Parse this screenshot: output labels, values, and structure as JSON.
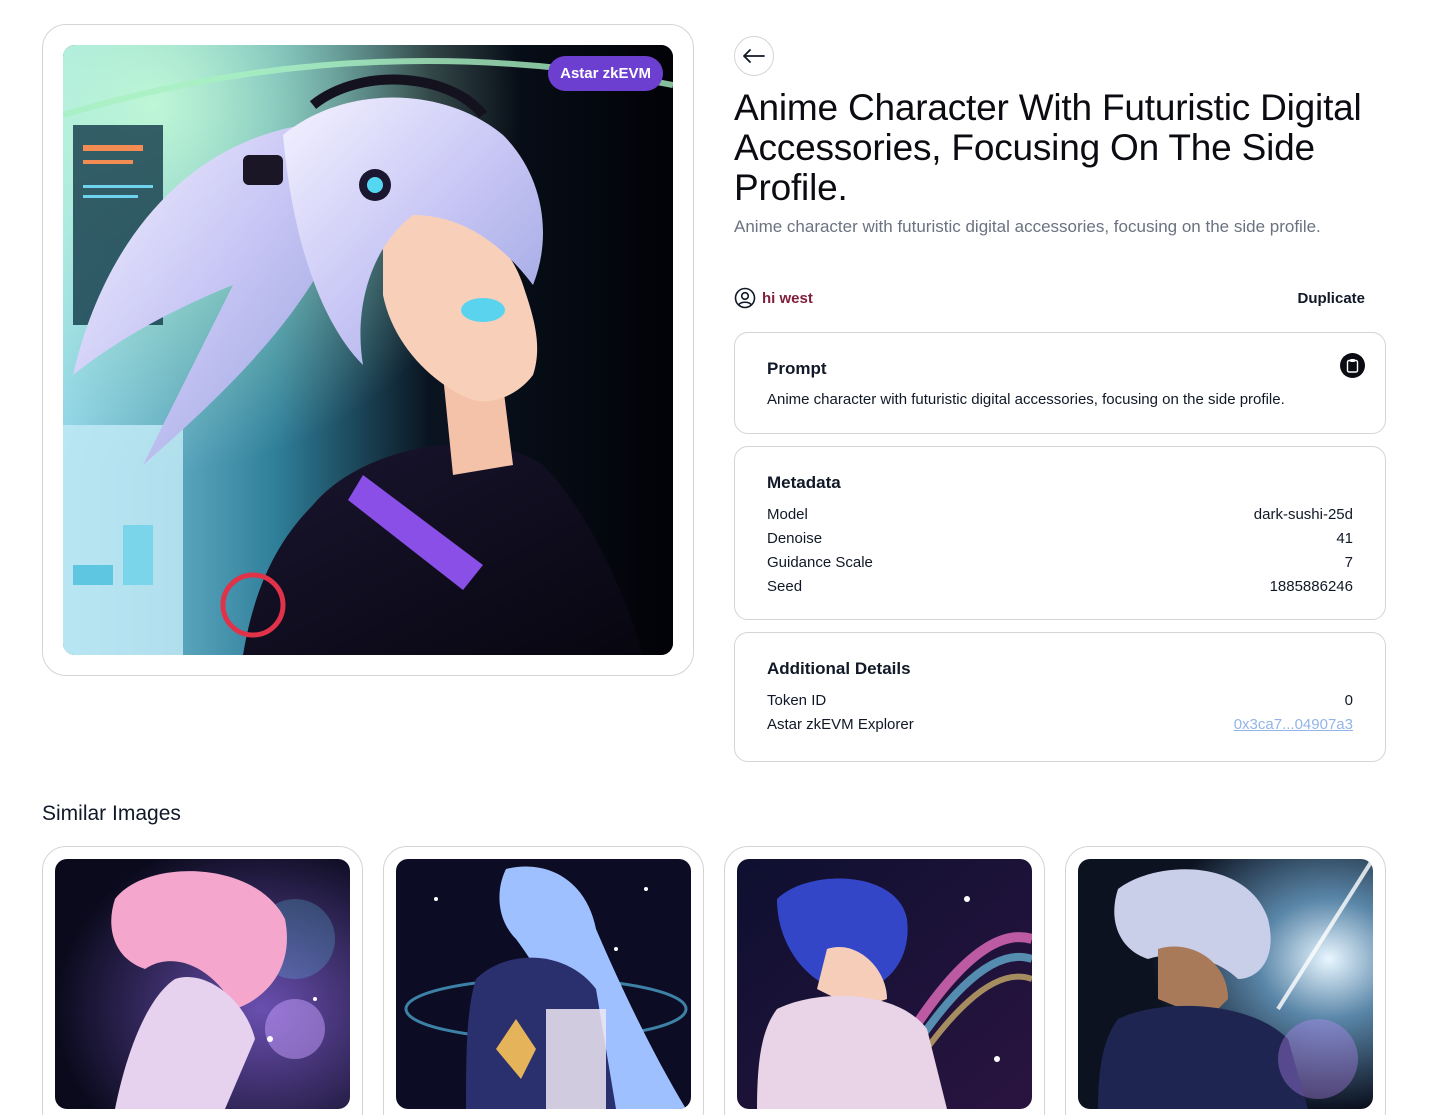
{
  "hero": {
    "chain_badge": "Astar zkEVM",
    "image_alt": "Anime character with futuristic digital accessories, side profile"
  },
  "header": {
    "back_icon": "arrow-left-icon",
    "title": "Anime Character With Futuristic Digital Accessories, Focusing On The Side Profile.",
    "subtitle": "Anime character with futuristic digital accessories, focusing on the side profile."
  },
  "author": {
    "icon": "user-circle-icon",
    "name": "hi west",
    "duplicate_label": "Duplicate"
  },
  "prompt": {
    "heading": "Prompt",
    "text": "Anime character with futuristic digital accessories, focusing on the side profile.",
    "copy_icon": "clipboard-icon"
  },
  "metadata": {
    "heading": "Metadata",
    "rows": [
      {
        "label": "Model",
        "value": "dark-sushi-25d"
      },
      {
        "label": "Denoise",
        "value": "41"
      },
      {
        "label": "Guidance Scale",
        "value": "7"
      },
      {
        "label": "Seed",
        "value": "1885886246"
      }
    ]
  },
  "additional": {
    "heading": "Additional Details",
    "rows": [
      {
        "label": "Token ID",
        "value": "0"
      },
      {
        "label": "Astar zkEVM Explorer",
        "value": "0x3ca7...04907a3"
      }
    ]
  },
  "similar": {
    "heading": "Similar Images"
  },
  "colors": {
    "badge": "#6d3fd1",
    "author": "#7f1d3a",
    "link": "#93b4e8",
    "border": "#d4d4d8"
  }
}
